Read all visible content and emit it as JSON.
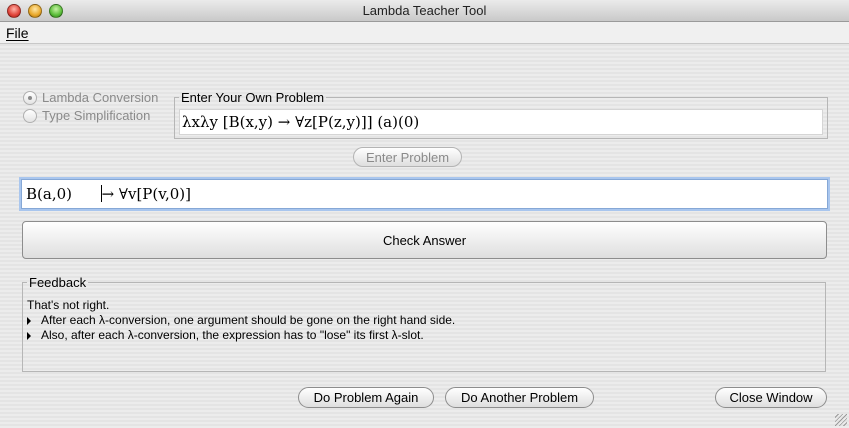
{
  "window": {
    "title": "Lambda Teacher Tool"
  },
  "menubar": {
    "file": "File"
  },
  "mode": {
    "options": [
      {
        "label": "Lambda Conversion",
        "selected": true
      },
      {
        "label": "Type Simplification",
        "selected": false
      }
    ]
  },
  "problem": {
    "legend": "Enter Your Own Problem",
    "value": "λxλy [B(x,y) → ∀z[P(z,y)]] (a)(0)",
    "enter_button": "Enter Problem"
  },
  "answer": {
    "value_before_caret": "B(a,0)      ",
    "value_after_caret": "→ ∀v[P(v,0)]",
    "check_button": "Check Answer"
  },
  "feedback": {
    "legend": "Feedback",
    "heading": "That's not right.",
    "items": [
      "After each λ-conversion, one argument should be gone on the right hand side.",
      "Also, after each λ-conversion, the expression has to \"lose\" its first λ-slot."
    ]
  },
  "footer": {
    "again_button": "Do Problem Again",
    "another_button": "Do Another Problem",
    "close_button": "Close Window"
  }
}
